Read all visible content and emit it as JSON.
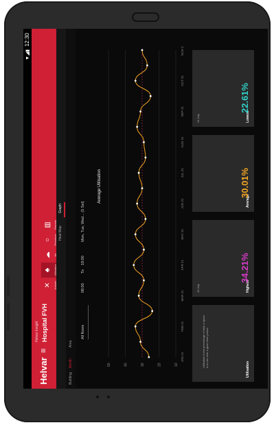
{
  "status": {
    "signal": "▼◢▮",
    "time": "12:30"
  },
  "app": {
    "logo": "Helvar",
    "menu_icon": "hamburger-icon",
    "subtitle": "Helvar Insight",
    "site": "Hospital FVH"
  },
  "nav": {
    "items": [
      {
        "label": "Activity",
        "icon": "✕"
      },
      {
        "label": "Utilisation",
        "icon": "♣"
      },
      {
        "label": "Air",
        "icon": "☁"
      },
      {
        "label": "Presence",
        "icon": "○"
      },
      {
        "label": "Reports",
        "icon": "▥"
      }
    ]
  },
  "view_tabs": [
    "Heat Map",
    "Graph"
  ],
  "tabs": [
    "Building",
    "Month",
    "Area"
  ],
  "filters": {
    "area": "All floors",
    "time_start": "08:00",
    "to_label": "To",
    "time_end": "18:00",
    "days": "Mon, Tue, Wed... (5 Sel)"
  },
  "chart_data": {
    "type": "line",
    "title": "Average Utilisation",
    "categories": [
      "JAN 21",
      "FEB 21",
      "MAR 21",
      "APR 21",
      "MAY 21",
      "JUN 21",
      "JUL 21",
      "AUG 21",
      "SEP 21",
      "OCT 21",
      "NOV 21"
    ],
    "x": [
      "JAN 21",
      "",
      "FEB 21",
      "",
      "MAR 21",
      "",
      "APR 21",
      "",
      "MAY 21",
      "",
      "JUN 21",
      "",
      "JUL 21",
      "",
      "AUG 21",
      "",
      "SEP 21",
      "",
      "OCT 21",
      "",
      "NOV 21"
    ],
    "values": [
      26,
      31,
      34,
      24,
      32,
      29,
      35,
      29,
      34,
      28,
      33,
      30,
      32,
      28,
      29,
      33,
      31,
      25,
      34,
      27,
      30
    ],
    "yticks": [
      "10",
      "20",
      "30",
      "40",
      "50"
    ],
    "ylim": [
      10,
      50
    ],
    "accent": "#f5a623"
  },
  "cards": {
    "utilisation": {
      "title": "Utilisation",
      "note": "Utilisation is the percentage of time a space is in use over a given time period"
    },
    "highest": {
      "title": "Highest",
      "value": "34.21%",
      "note": "15 July",
      "color": "#d63ac7"
    },
    "average": {
      "title": "Average",
      "value": "30.01%",
      "color": "#f5a623"
    },
    "lowest": {
      "title": "Lowest",
      "value": "22.61%",
      "note": "24 July",
      "color": "#2fd0c8"
    }
  }
}
